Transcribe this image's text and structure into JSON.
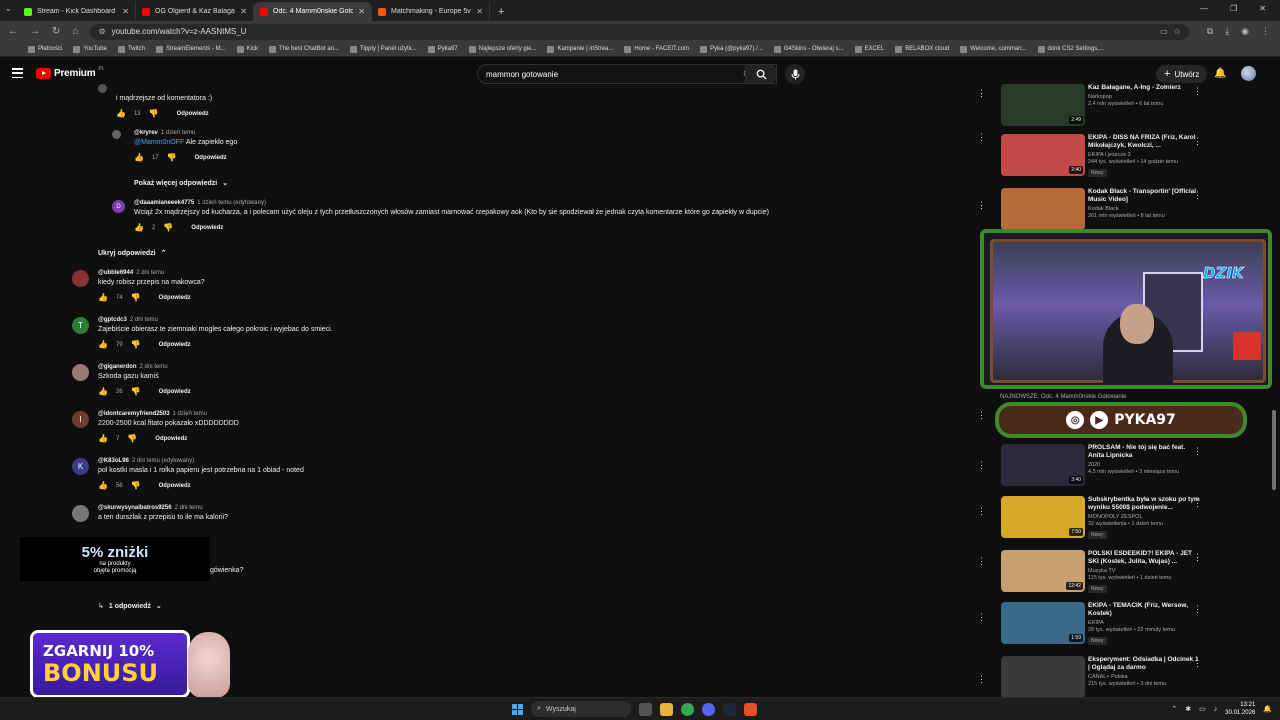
{
  "browser": {
    "tabs": [
      {
        "title": "Stream - Kick Dashboard",
        "color": "#53fc18"
      },
      {
        "title": "OG Olgierd & Kaz Balagane - Y",
        "color": "#ff0000"
      },
      {
        "title": "Odc. 4 Mamm0nskie Gotowanie",
        "color": "#ff0000"
      },
      {
        "title": "Matchmaking - Europe 5v5 Qu",
        "color": "#ff5500"
      }
    ],
    "url": "youtube.com/watch?v=z-AASNtMS_U",
    "bookmarks": [
      "Płatności",
      "YouTube",
      "Twitch",
      "StreamElements - M...",
      "Kick",
      "The best ChatBot an...",
      "Tipply | Panel użytk...",
      "Pyka97",
      "Najlepsze oferty gie...",
      "Kampanie | inStrea...",
      "Home - FACEIT.com",
      "Pyka (@pyka97) /...",
      "G4Skins - Otwieraj s...",
      "EXCEL",
      "BELABOX cloud",
      "Welcome, comman...",
      "donk CS2 Settings,..."
    ]
  },
  "header": {
    "logo_word": "Premium",
    "logo_region": "PL",
    "search_query": "mammon gotowanie",
    "kb_label": "⌨",
    "create_label": "Utwórz"
  },
  "comments": {
    "top_text": "i mądrzejsze od komentatora :)",
    "top_likes": "13",
    "reply1": {
      "author": "@kryrev",
      "time": "1 dzień temu",
      "mention": "@Mamm0nOFF",
      "text": " Ale zapiekło ego",
      "likes": "17"
    },
    "more_replies": "Pokaż więcej odpowiedzi",
    "reply2": {
      "author": "@daaamianeeek4775",
      "time": "1 dzień temu (edytowany)",
      "text": "Wciąż 2x mądrzejszy od kucharza, a i polecam użyć oleju z tych przetłuszczonych włosów zamiast marnować rzepakowy aok (Kto by sie spodziewał że jednak czyta komentarze które go zapiekły w dupcie)",
      "likes": "2",
      "avatar": "D"
    },
    "hide_replies": "Ukryj odpowiedzi",
    "reply_label": "Odpowiedz",
    "items": [
      {
        "author": "@ubble6944",
        "time": "2 dni temu",
        "text": "kiedy robisz przepis na makowca?",
        "likes": "74",
        "avatar": "",
        "color": "#8a3030"
      },
      {
        "author": "@gptcdc3",
        "time": "2 dni temu",
        "text": "Zajebiście obierasz te ziemniaki mogles całego pokroic i wyjebac do smieci.",
        "likes": "79",
        "avatar": "T",
        "color": "#2f7d32"
      },
      {
        "author": "@giganerdon",
        "time": "2 dni temu",
        "text": "Szkoda gazu kamiś",
        "likes": "26",
        "avatar": "",
        "color": "#9a7a70"
      },
      {
        "author": "@idontcaremyfriend2503",
        "time": "1 dzień temu",
        "text": "2200-2500 kcal fitato pokazało xDDDDDDDD",
        "likes": "7",
        "avatar": "I",
        "color": "#6d3c32"
      },
      {
        "author": "@K83oL98",
        "time": "2 dni temu (edytowany)",
        "text": "pol kostki masla i 1 rolka papieru jest potrzebna na 1 obiad - noted",
        "likes": "56",
        "avatar": "K",
        "color": "#3d3a8a"
      },
      {
        "author": "@skurwysynalbatros9256",
        "time": "2 dni temu",
        "text": "a ten durszlak z przepisu to ile ma kalorii?",
        "likes": "",
        "avatar": "",
        "color": "#777"
      }
    ],
    "partial_text": "gówienka?",
    "one_reply": "1 odpowiedź"
  },
  "sidebar": {
    "videos": [
      {
        "title": "Kaz Bałagane, A-Ing - Żołnierz",
        "channel": "Narkopop",
        "stats": "2,4 mln wyświetleń • 6 lat temu",
        "duration": "2:49",
        "badge": "",
        "thumb": "#2a3a2a"
      },
      {
        "title": "EKIPA - DISS NA FRIZA (Friz, Karol Mikołajczyk, Kwolczi, ...",
        "channel": "EKIPA i jeszcze 3",
        "stats": "244 tys. wyświetleń • 14 godzin temu",
        "duration": "2:40",
        "badge": "Nowy",
        "thumb": "#c44a4a"
      },
      {
        "title": "Kodak Black - Transportin' [Official Music Video]",
        "channel": "Kodak Black",
        "stats": "261 mln wyświetleń • 8 lat temu",
        "duration": "",
        "badge": "",
        "thumb": "#b86a3a"
      },
      {
        "title": "PROLSAM - Nie tój się bać feat. Anita Lipnicka",
        "channel": "2020",
        "stats": "4,5 mln wyświetleń • 3 miesiące temu",
        "duration": "3:40",
        "badge": "",
        "thumb": "#2a2a3a"
      },
      {
        "title": "Subskrybentka była w szoku po tym wyniku 5500$ podwojenie...",
        "channel": "MONOPOLY ZESPOL",
        "stats": "32 wyświetlenia • 1 dzień temu",
        "duration": "7:50",
        "badge": "Nowy",
        "thumb": "#d8a82a"
      },
      {
        "title": "POLSKI ESDEEKID?! EKIPA - JET SKI (Kostek, Julita, Wujas) ...",
        "channel": "Muzyka TV",
        "stats": "115 tys. wyświetleń • 1 dzień temu",
        "duration": "12:42",
        "badge": "Nowy",
        "thumb": "#c8a070"
      },
      {
        "title": "EKIPA - TEMACIK (Friz, Wersow, Kostek)",
        "channel": "EKIPA",
        "stats": "29 tys. wyświetleń • 22 minuty temu",
        "duration": "1:59",
        "badge": "Nowy",
        "thumb": "#3a6a8a"
      },
      {
        "title": "Eksperyment: Odsiadka | Odcinek 1 | Oglądaj za darmo",
        "channel": "CANAL+ Polska",
        "stats": "215 tys. wyświetleń • 3 dni temu",
        "duration": "",
        "badge": "",
        "thumb": "#3a3a3a"
      }
    ],
    "social_under": "NAJNOWSZE: Odc. 4 Mamm0nskie Gotowanie",
    "cam_brand": "DZIK",
    "social_handle": "PYKA97"
  },
  "overlays": {
    "promo_big": "5% zniżki",
    "promo_small_1": "na produkty",
    "promo_small_2": "objęte promocją",
    "bonus_1": "ZGARNIJ 10%",
    "bonus_2": "BONUSU"
  },
  "taskbar": {
    "search": "Wyszukaj",
    "time": "13:21",
    "date": "30.01.2026"
  },
  "colors": {
    "accent": "#ff0000",
    "link": "#3ea6ff",
    "background": "#0f0f0f",
    "frame": "#3c8a2c"
  }
}
